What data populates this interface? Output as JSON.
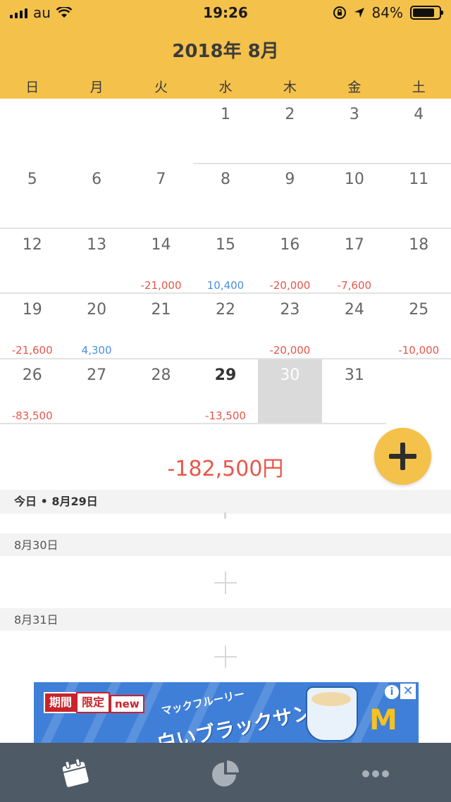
{
  "status_bar": {
    "carrier": "au",
    "time": "19:26",
    "battery": "84%",
    "battery_level": 0.84
  },
  "header": {
    "month_title": "2018年 8月",
    "weekdays": [
      "日",
      "月",
      "火",
      "水",
      "木",
      "金",
      "土"
    ]
  },
  "calendar": {
    "days": [
      {
        "day": "1",
        "amount": ""
      },
      {
        "day": "2",
        "amount": ""
      },
      {
        "day": "3",
        "amount": ""
      },
      {
        "day": "4",
        "amount": ""
      },
      {
        "day": "5",
        "amount": ""
      },
      {
        "day": "6",
        "amount": ""
      },
      {
        "day": "7",
        "amount": ""
      },
      {
        "day": "8",
        "amount": ""
      },
      {
        "day": "9",
        "amount": ""
      },
      {
        "day": "10",
        "amount": ""
      },
      {
        "day": "11",
        "amount": ""
      },
      {
        "day": "12",
        "amount": ""
      },
      {
        "day": "13",
        "amount": ""
      },
      {
        "day": "14",
        "amount": "-21,000"
      },
      {
        "day": "15",
        "amount": "10,400"
      },
      {
        "day": "16",
        "amount": "-20,000"
      },
      {
        "day": "17",
        "amount": "-7,600"
      },
      {
        "day": "18",
        "amount": ""
      },
      {
        "day": "19",
        "amount": "-21,600"
      },
      {
        "day": "20",
        "amount": "4,300"
      },
      {
        "day": "21",
        "amount": ""
      },
      {
        "day": "22",
        "amount": ""
      },
      {
        "day": "23",
        "amount": "-20,000"
      },
      {
        "day": "24",
        "amount": ""
      },
      {
        "day": "25",
        "amount": "-10,000"
      },
      {
        "day": "26",
        "amount": "-83,500"
      },
      {
        "day": "27",
        "amount": ""
      },
      {
        "day": "28",
        "amount": ""
      },
      {
        "day": "29",
        "amount": "-13,500"
      },
      {
        "day": "30",
        "amount": ""
      },
      {
        "day": "31",
        "amount": ""
      }
    ],
    "today": "29",
    "selected": "30"
  },
  "summary": {
    "total": "-182,500円"
  },
  "day_list": {
    "today_label": "今日 • 8月29日",
    "day2_label": "8月30日",
    "day3_label": "8月31日"
  },
  "ad": {
    "tag1": "期間",
    "tag2": "限定",
    "new": "new",
    "subtitle": "マックフルーリー",
    "title": "白いブラックサンダー",
    "logo": "M",
    "info": "i",
    "close": "✕"
  },
  "tabbar": {
    "tabs": [
      "calendar-icon",
      "pie-chart-icon",
      "more-icon"
    ]
  },
  "colors": {
    "header": "#F4C14B",
    "negative": "#E8564A",
    "positive": "#4A90E2",
    "tabbar": "#4E5A66"
  }
}
